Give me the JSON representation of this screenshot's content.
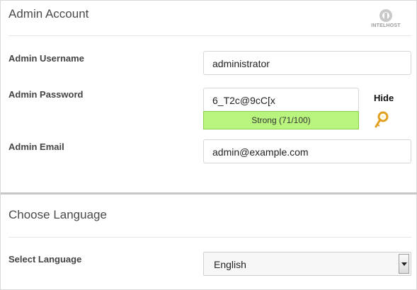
{
  "admin_account": {
    "title": "Admin Account",
    "logo_text": "INTELHOST",
    "username": {
      "label": "Admin Username",
      "value": "administrator"
    },
    "password": {
      "label": "Admin Password",
      "value": "6_T2c@9cC[x",
      "strength_text": "Strong (71/100)",
      "strength_score": 71,
      "hide_label": "Hide",
      "key_icon": "key-icon"
    },
    "email": {
      "label": "Admin Email",
      "value": "admin@example.com"
    }
  },
  "language": {
    "title": "Choose Language",
    "select_label": "Select Language",
    "selected": "English"
  },
  "colors": {
    "strength_fill": "#b9f57e",
    "key_gold": "#e0a020"
  }
}
